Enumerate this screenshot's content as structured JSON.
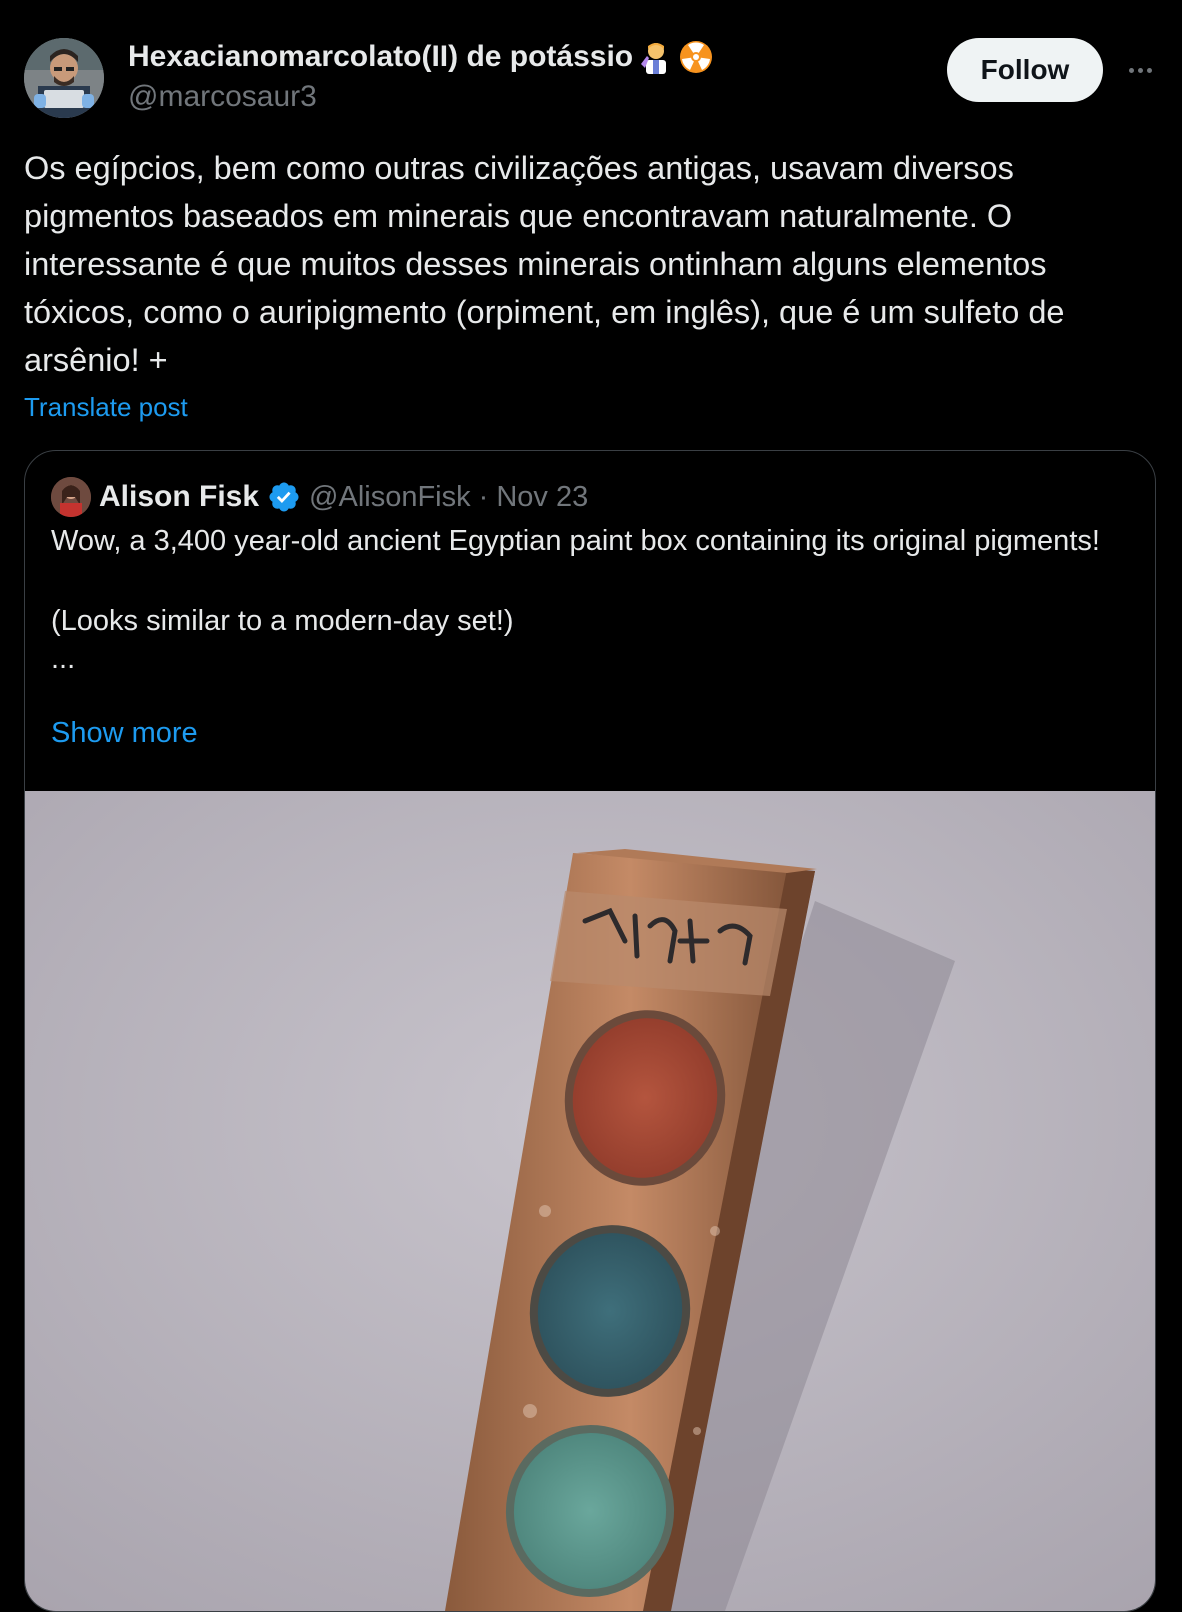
{
  "post": {
    "author_name": "Hexacianomarcolato(II) de potássio",
    "author_handle": "@marcosaur3",
    "emojis": [
      "scientist-emoji",
      "radioactive-emoji"
    ],
    "follow_label": "Follow",
    "text": "Os egípcios, bem como outras civilizações antigas, usavam diversos pigmentos baseados em minerais que encontravam naturalmente. O interessante é que muitos desses minerais ontinham alguns elementos tóxicos, como o auripigmento (orpiment, em inglês), que é um sulfeto de arsênio! +",
    "translate_label": "Translate post"
  },
  "quote": {
    "author_name": "Alison Fisk",
    "author_handle": "@AlisonFisk",
    "separator": "·",
    "date": "Nov 23",
    "line1": "Wow, a 3,400 year-old ancient Egyptian paint box containing its original pigments!",
    "line2": "(Looks similar to a modern-day set!)",
    "ellipsis": "...",
    "show_more_label": "Show more"
  },
  "colors": {
    "background": "#000000",
    "text": "#e7e9ea",
    "muted": "#71767b",
    "link": "#1d9bf0",
    "verified": "#1d9bf0"
  }
}
